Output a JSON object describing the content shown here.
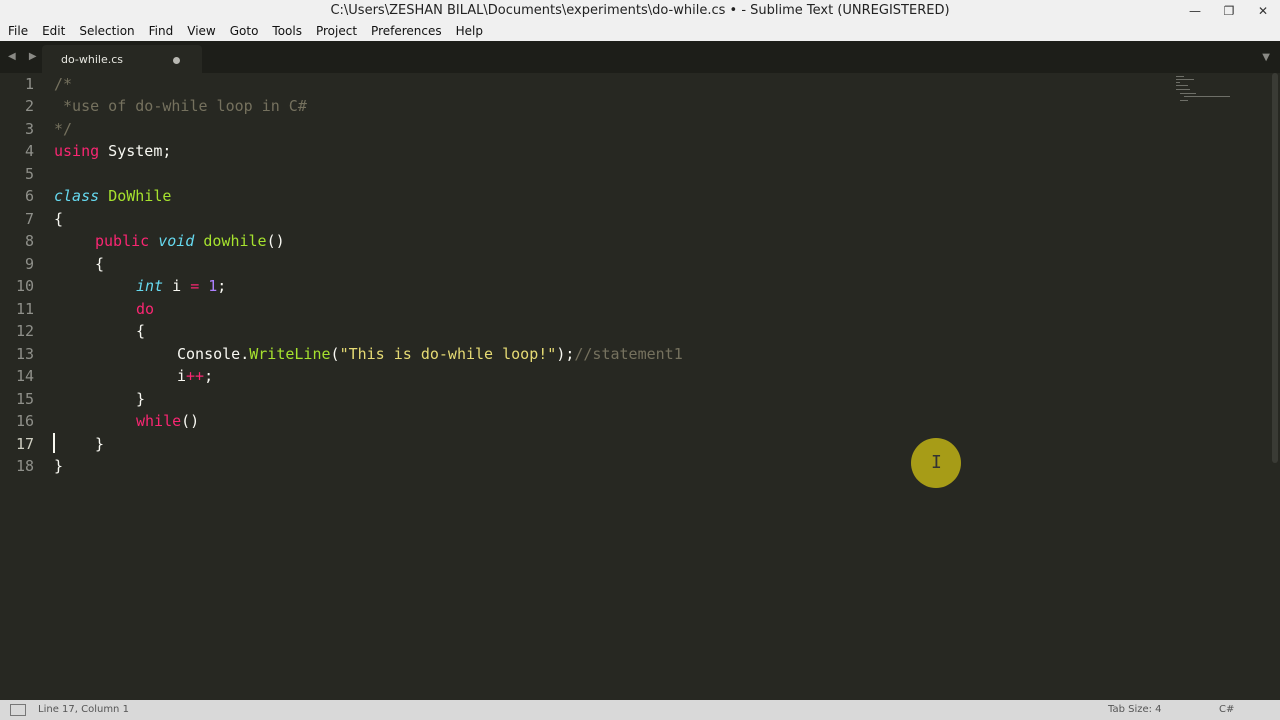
{
  "window": {
    "title": "C:\\Users\\ZESHAN BILAL\\Documents\\experiments\\do-while.cs • - Sublime Text (UNREGISTERED)",
    "minimize": "—",
    "maximize": "❐",
    "close": "✕"
  },
  "menu": [
    "File",
    "Edit",
    "Selection",
    "Find",
    "View",
    "Goto",
    "Tools",
    "Project",
    "Preferences",
    "Help"
  ],
  "tabs": {
    "nav": "◀ ▶",
    "active": "do-while.cs",
    "dropdown": "▼"
  },
  "editor": {
    "line_numbers": [
      "1",
      "2",
      "3",
      "4",
      "5",
      "6",
      "7",
      "8",
      "9",
      "10",
      "11",
      "12",
      "13",
      "14",
      "15",
      "16",
      "17",
      "18"
    ],
    "lines": {
      "l1": "/*",
      "l2": " *use of do-while loop in C#",
      "l3": "*/",
      "l4_kw": "using",
      "l4_rest": " System;",
      "l6_kw": "class",
      "l6_name": "DoWhile",
      "l7": "{",
      "l8_kw": "public",
      "l8_ty": "void",
      "l8_fn": "dowhile",
      "l8_rest": "()",
      "l9": "{",
      "l10_ty": "int",
      "l10_mid": " i ",
      "l10_op": "=",
      "l10_num": "1",
      "l10_end": ";",
      "l11_kw": "do",
      "l12": "{",
      "l13_obj": "Console.",
      "l13_fn": "WriteLine",
      "l13_open": "(",
      "l13_str": "\"This is do-while loop!\"",
      "l13_close": ");",
      "l13_cm": "//statement1",
      "l14_var": "i",
      "l14_op": "++",
      "l14_end": ";",
      "l15": "}",
      "l16_kw": "while",
      "l16_rest": "()",
      "l17": "}",
      "l18": "}"
    }
  },
  "status": {
    "position": "Line 17, Column 1",
    "tab_size": "Tab Size: 4",
    "syntax": "C#"
  },
  "colors": {
    "background": "#272822",
    "keyword": "#f92672",
    "type": "#66d9ef",
    "function": "#a6e22e",
    "string": "#e6db74",
    "number": "#ae81ff",
    "comment": "#75715e"
  }
}
